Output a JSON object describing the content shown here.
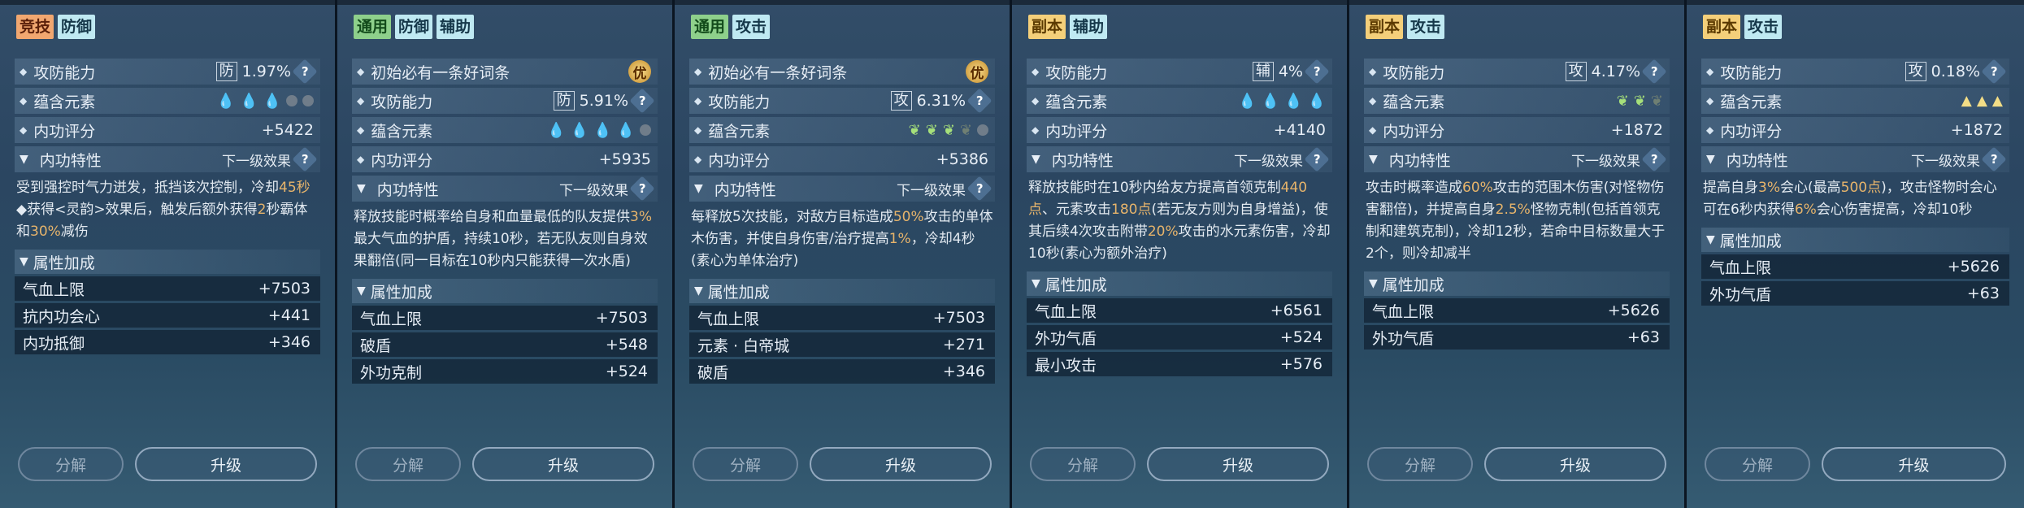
{
  "labels": {
    "attack_defense": "攻防能力",
    "element": "蕴含元素",
    "score": "内功评分",
    "trait": "内功特性",
    "next_level": "下一级效果",
    "attr_head": "属性加成",
    "must_have": "初始必有一条好词条",
    "you_badge": "优",
    "help": "?",
    "decompose": "分解",
    "upgrade": "升级"
  },
  "panels": [
    {
      "tags": [
        {
          "text": "竞技",
          "color": "orange"
        },
        {
          "text": "防御",
          "color": "cyan"
        }
      ],
      "stat_char": "防",
      "stat_value": "1.97%",
      "score": "+5422",
      "desc_parts": [
        {
          "t": "受到强控时气力迸发，抵挡该次控制，冷却"
        },
        {
          "t": "45秒",
          "hi": true
        },
        {
          "t": "\n◆获得<灵韵>效果后，触发后额外获得"
        },
        {
          "t": "2",
          "hi": true
        },
        {
          "t": "秒霸体和"
        },
        {
          "t": "30%",
          "hi": true
        },
        {
          "t": "减伤"
        }
      ],
      "attrs": [
        {
          "name": "气血上限",
          "value": "+7503"
        },
        {
          "name": "抗内功会心",
          "value": "+441"
        },
        {
          "name": "内功抵御",
          "value": "+346"
        }
      ]
    },
    {
      "tags": [
        {
          "text": "通用",
          "color": "green"
        },
        {
          "text": "防御",
          "color": "cyan"
        },
        {
          "text": "辅助",
          "color": "cyan"
        }
      ],
      "stat_char": "防",
      "stat_value": "5.91%",
      "score": "+5935",
      "desc_parts": [
        {
          "t": "释放技能时概率给自身和血量最低的队友提供"
        },
        {
          "t": "3%",
          "hi": true
        },
        {
          "t": "最大气血的护盾，持续10秒，若无队友则自身效果翻倍(同一目标在10秒内只能获得一次水盾)"
        }
      ],
      "attrs": [
        {
          "name": "气血上限",
          "value": "+7503"
        },
        {
          "name": "破盾",
          "value": "+548"
        },
        {
          "name": "外功克制",
          "value": "+524"
        }
      ]
    },
    {
      "tags": [
        {
          "text": "通用",
          "color": "green"
        },
        {
          "text": "攻击",
          "color": "cyan"
        }
      ],
      "stat_char": "攻",
      "stat_value": "6.31%",
      "score": "+5386",
      "desc_parts": [
        {
          "t": "每释放5次技能，对敌方目标造成"
        },
        {
          "t": "50%",
          "hi": true
        },
        {
          "t": "攻击的单体木伤害，并使自身伤害/治疗提高"
        },
        {
          "t": "1%",
          "hi": true
        },
        {
          "t": "，冷却4秒(素心为单体治疗)"
        }
      ],
      "attrs": [
        {
          "name": "气血上限",
          "value": "+7503"
        },
        {
          "name": "元素 · 白帝城",
          "value": "+271"
        },
        {
          "name": "破盾",
          "value": "+346"
        }
      ]
    },
    {
      "tags": [
        {
          "text": "副本",
          "color": "yellow"
        },
        {
          "text": "辅助",
          "color": "cyan"
        }
      ],
      "stat_char": "辅",
      "stat_value": "4%",
      "score": "+4140",
      "desc_parts": [
        {
          "t": "释放技能时在10秒内给友方提高首领克制"
        },
        {
          "t": "440点",
          "hi": true
        },
        {
          "t": "、元素攻击"
        },
        {
          "t": "180点",
          "hi": true
        },
        {
          "t": "(若无友方则为自身增益)，使其后续4次攻击附带"
        },
        {
          "t": "20%",
          "hi": true
        },
        {
          "t": "攻击的水元素伤害，冷却10秒(素心为额外治疗)"
        }
      ],
      "attrs": [
        {
          "name": "气血上限",
          "value": "+6561"
        },
        {
          "name": "外功气盾",
          "value": "+524"
        },
        {
          "name": "最小攻击",
          "value": "+576"
        }
      ]
    },
    {
      "tags": [
        {
          "text": "副本",
          "color": "yellow"
        },
        {
          "text": "攻击",
          "color": "cyan"
        }
      ],
      "stat_char": "攻",
      "stat_value": "4.17%",
      "score": "+1872",
      "desc_parts": [
        {
          "t": "攻击时概率造成"
        },
        {
          "t": "60%",
          "hi": true
        },
        {
          "t": "攻击的范围木伤害(对怪物伤害翻倍)，并提高自身"
        },
        {
          "t": "2.5%",
          "hi": true
        },
        {
          "t": "怪物克制(包括首领克制和建筑克制)，冷却12秒，若命中目标数量大于2个，则冷却减半"
        }
      ],
      "attrs": [
        {
          "name": "气血上限",
          "value": "+5626"
        },
        {
          "name": "外功气盾",
          "value": "+63"
        }
      ]
    },
    {
      "tags": [
        {
          "text": "副本",
          "color": "yellow"
        },
        {
          "text": "攻击",
          "color": "cyan"
        }
      ],
      "stat_char": "攻",
      "stat_value": "0.18%",
      "score": "+1872",
      "desc_parts": [
        {
          "t": "提高自身"
        },
        {
          "t": "3%",
          "hi": true
        },
        {
          "t": "会心(最高"
        },
        {
          "t": "500点",
          "hi": true
        },
        {
          "t": ")，攻击怪物时会心可在6秒内获得"
        },
        {
          "t": "6%",
          "hi": true
        },
        {
          "t": "会心伤害提高，冷却10秒"
        }
      ],
      "attrs": [
        {
          "name": "气血上限",
          "value": "+5626"
        },
        {
          "name": "外功气盾",
          "value": "+63"
        }
      ]
    }
  ]
}
